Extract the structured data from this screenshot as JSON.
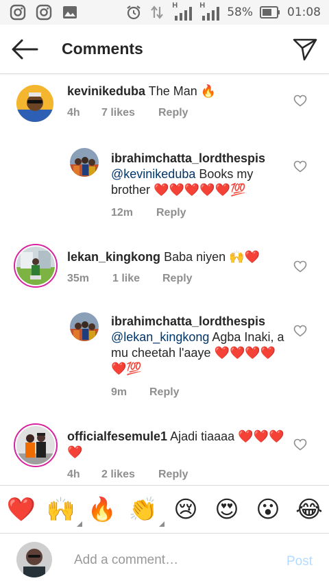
{
  "status_bar": {
    "battery_percent": "58%",
    "time": "01:08",
    "signal_label_1": "H",
    "signal_label_2": "H",
    "icons": [
      "instagram-icon",
      "instagram-icon",
      "gallery-icon",
      "alarm-icon",
      "data-arrows-icon",
      "signal-icon",
      "signal-icon",
      "battery-icon"
    ]
  },
  "header": {
    "title": "Comments"
  },
  "comments": [
    {
      "username": "kevinikeduba",
      "text": "The Man",
      "emoji": "🔥",
      "time": "4h",
      "likes": "7 likes",
      "reply_label": "Reply",
      "is_reply": false
    },
    {
      "username": "ibrahimchatta_lordthespis",
      "mention": "@kevinikeduba",
      "text": "Books my brother",
      "emoji": "❤️❤️❤️❤️❤️💯",
      "time": "12m",
      "likes": "",
      "reply_label": "Reply",
      "is_reply": true
    },
    {
      "username": "lekan_kingkong",
      "text": "Baba niyen",
      "emoji": "🙌❤️",
      "time": "35m",
      "likes": "1 like",
      "reply_label": "Reply",
      "is_reply": false
    },
    {
      "username": "ibrahimchatta_lordthespis",
      "mention": "@lekan_kingkong",
      "text": "Agba Inaki, a mu cheetah l'aaye",
      "emoji": "❤️❤️❤️❤️❤️💯",
      "time": "9m",
      "likes": "",
      "reply_label": "Reply",
      "is_reply": true
    },
    {
      "username": "officialfesemule1",
      "text": "Ajadi tiaaaa",
      "emoji": "❤️❤️❤️❤️",
      "time": "4h",
      "likes": "2 likes",
      "reply_label": "Reply",
      "is_reply": false
    }
  ],
  "emoji_bar": [
    "❤️",
    "🙌",
    "🔥",
    "👏",
    "😢",
    "😍",
    "😮",
    "😂"
  ],
  "input_bar": {
    "placeholder": "Add a comment…",
    "post_label": "Post"
  },
  "colors": {
    "mention": "#003569",
    "meta_gray": "#8e8e8e",
    "post_disabled": "#b3dbff",
    "story_ring": "#d6249f"
  }
}
